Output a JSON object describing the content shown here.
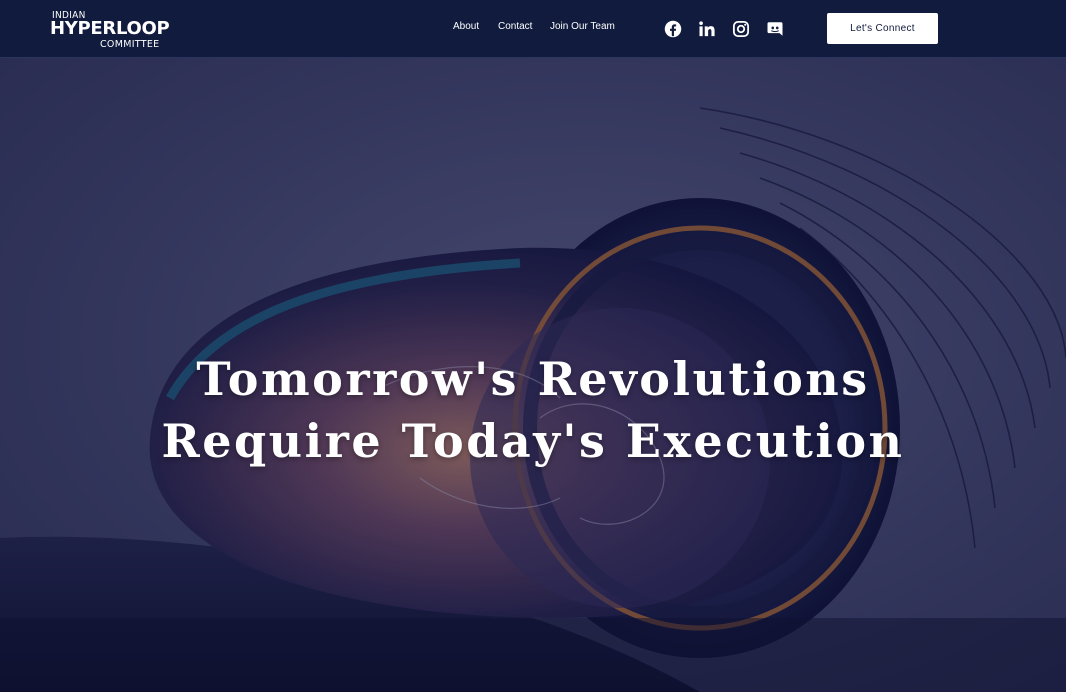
{
  "logo": {
    "line1": "INDIAN",
    "line2": "HYPERLOOP",
    "line3": "COMMITTEE"
  },
  "nav": {
    "items": [
      {
        "label": "About"
      },
      {
        "label": "Contact"
      },
      {
        "label": "Join Our Team"
      }
    ]
  },
  "social": [
    {
      "icon": "facebook-icon"
    },
    {
      "icon": "linkedin-icon"
    },
    {
      "icon": "instagram-icon"
    },
    {
      "icon": "discord-icon"
    }
  ],
  "cta": {
    "label": "Let's Connect"
  },
  "hero": {
    "title_line1": "Tomorrow's Revolutions",
    "title_line2": "Require Today's Execution"
  },
  "colors": {
    "nav_bg": "#101b3d",
    "hero_tint": "#2a2d5e",
    "accent_orange": "#c8782e",
    "accent_teal": "#1f6f86",
    "button_bg": "#ffffff",
    "text": "#ffffff"
  }
}
